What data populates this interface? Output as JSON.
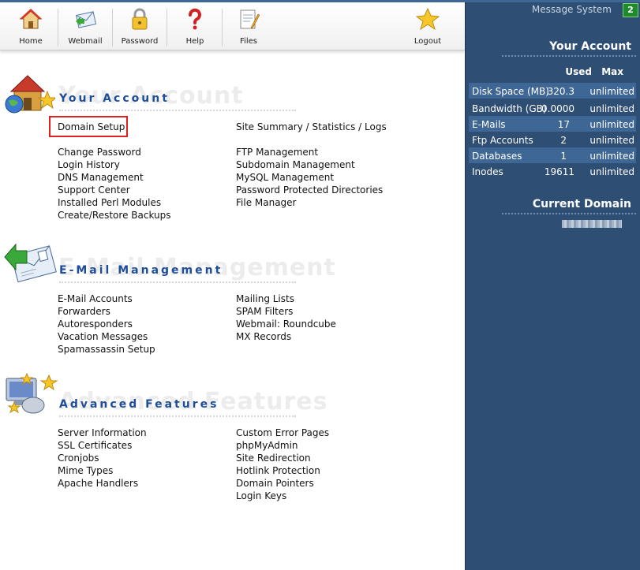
{
  "toolbar": {
    "home": "Home",
    "webmail": "Webmail",
    "password": "Password",
    "help": "Help",
    "files": "Files",
    "logout": "Logout"
  },
  "sidebar": {
    "message_system": "Message System",
    "message_count": "2",
    "your_account_title": "Your Account",
    "col_used": "Used",
    "col_max": "Max",
    "stats": [
      {
        "name": "Disk Space (MB)",
        "used": "320.3",
        "max": "unlimited"
      },
      {
        "name": "Bandwidth (GB)",
        "used": "0.0000",
        "max": "unlimited"
      },
      {
        "name": "E-Mails",
        "used": "17",
        "max": "unlimited"
      },
      {
        "name": "Ftp Accounts",
        "used": "2",
        "max": "unlimited"
      },
      {
        "name": "Databases",
        "used": "1",
        "max": "unlimited"
      },
      {
        "name": "Inodes",
        "used": "19611",
        "max": "unlimited"
      }
    ],
    "current_domain_title": "Current Domain"
  },
  "sections": {
    "your_account": {
      "title": "Your Account",
      "ghost": "Your Account",
      "col1": [
        "Domain Setup",
        "Change Password",
        "Login History",
        "DNS Management",
        "Support Center",
        "Installed Perl Modules",
        "Create/Restore Backups"
      ],
      "col2": [
        "Site Summary / Statistics / Logs",
        "FTP Management",
        "Subdomain Management",
        "MySQL Management",
        "Password Protected Directories",
        "File Manager"
      ]
    },
    "email": {
      "title": "E-Mail Management",
      "ghost": "E-Mail Management",
      "col1": [
        "E-Mail Accounts",
        "Forwarders",
        "Autoresponders",
        "Vacation Messages",
        "Spamassassin Setup"
      ],
      "col2": [
        "Mailing Lists",
        "SPAM Filters",
        "Webmail: Roundcube",
        "MX Records"
      ]
    },
    "advanced": {
      "title": "Advanced Features",
      "ghost": "Advanced Features",
      "col1": [
        "Server Information",
        "SSL Certificates",
        "Cronjobs",
        "Mime Types",
        "Apache Handlers"
      ],
      "col2": [
        "Custom Error Pages",
        "phpMyAdmin",
        "Site Redirection",
        "Hotlink Protection",
        "Domain Pointers",
        "Login Keys"
      ]
    }
  },
  "colors": {
    "sidebar_bg": "#2f4e74",
    "section_title": "#1e4e9a",
    "highlight_box": "#e02020",
    "badge": "#1f8a2c"
  }
}
